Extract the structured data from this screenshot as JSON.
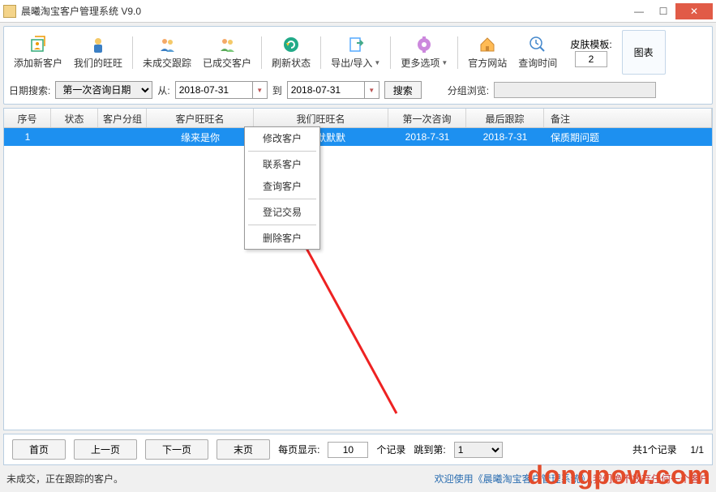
{
  "window": {
    "title": "晨曦淘宝客户管理系统 V9.0"
  },
  "toolbar": {
    "add_customer": "添加新客户",
    "our_wangwang": "我们的旺旺",
    "untraded_followup": "未成交跟踪",
    "traded_customer": "已成交客户",
    "refresh_status": "刷新状态",
    "export_import": "导出/导入",
    "more_options": "更多选项",
    "official_site": "官方网站",
    "query_time": "查询时间",
    "skin_label": "皮肤模板:",
    "skin_value": "2",
    "chart": "图表"
  },
  "search": {
    "date_search_label": "日期搜索:",
    "date_type": "第一次咨询日期",
    "from_label": "从:",
    "from_date": "2018-07-31",
    "to_label": "到",
    "to_date": "2018-07-31",
    "search_btn": "搜索",
    "group_browse_label": "分组浏览:"
  },
  "grid": {
    "headers": {
      "seq": "序号",
      "status": "状态",
      "group": "客户分组",
      "ww": "客户旺旺名",
      "ourww": "我们旺旺名",
      "first": "第一次咨询",
      "last": "最后跟踪",
      "remark": "备注"
    },
    "rows": [
      {
        "seq": "1",
        "status": "",
        "group": "",
        "ww": "缘来是你",
        "ourww": "默默默默默",
        "first": "2018-7-31",
        "last": "2018-7-31",
        "remark": "保质期问题"
      }
    ]
  },
  "context_menu": {
    "edit": "修改客户",
    "contact": "联系客户",
    "query": "查询客户",
    "register": "登记交易",
    "delete": "删除客户"
  },
  "pager": {
    "first": "首页",
    "prev": "上一页",
    "next": "下一页",
    "last": "末页",
    "per_page_label": "每页显示:",
    "per_page": "10",
    "records_label": "个记录",
    "jump_label": "跳到第:",
    "jump_value": "1",
    "total": "共1个记录",
    "page": "1/1"
  },
  "statusbar": {
    "left": "未成交，正在跟踪的客户。",
    "right_prefix": "欢迎使用《晨曦淘宝客户管理系统》,",
    "right_suffix": "我们绝不放弃任何一个客户"
  },
  "watermark": "dongpow.com"
}
